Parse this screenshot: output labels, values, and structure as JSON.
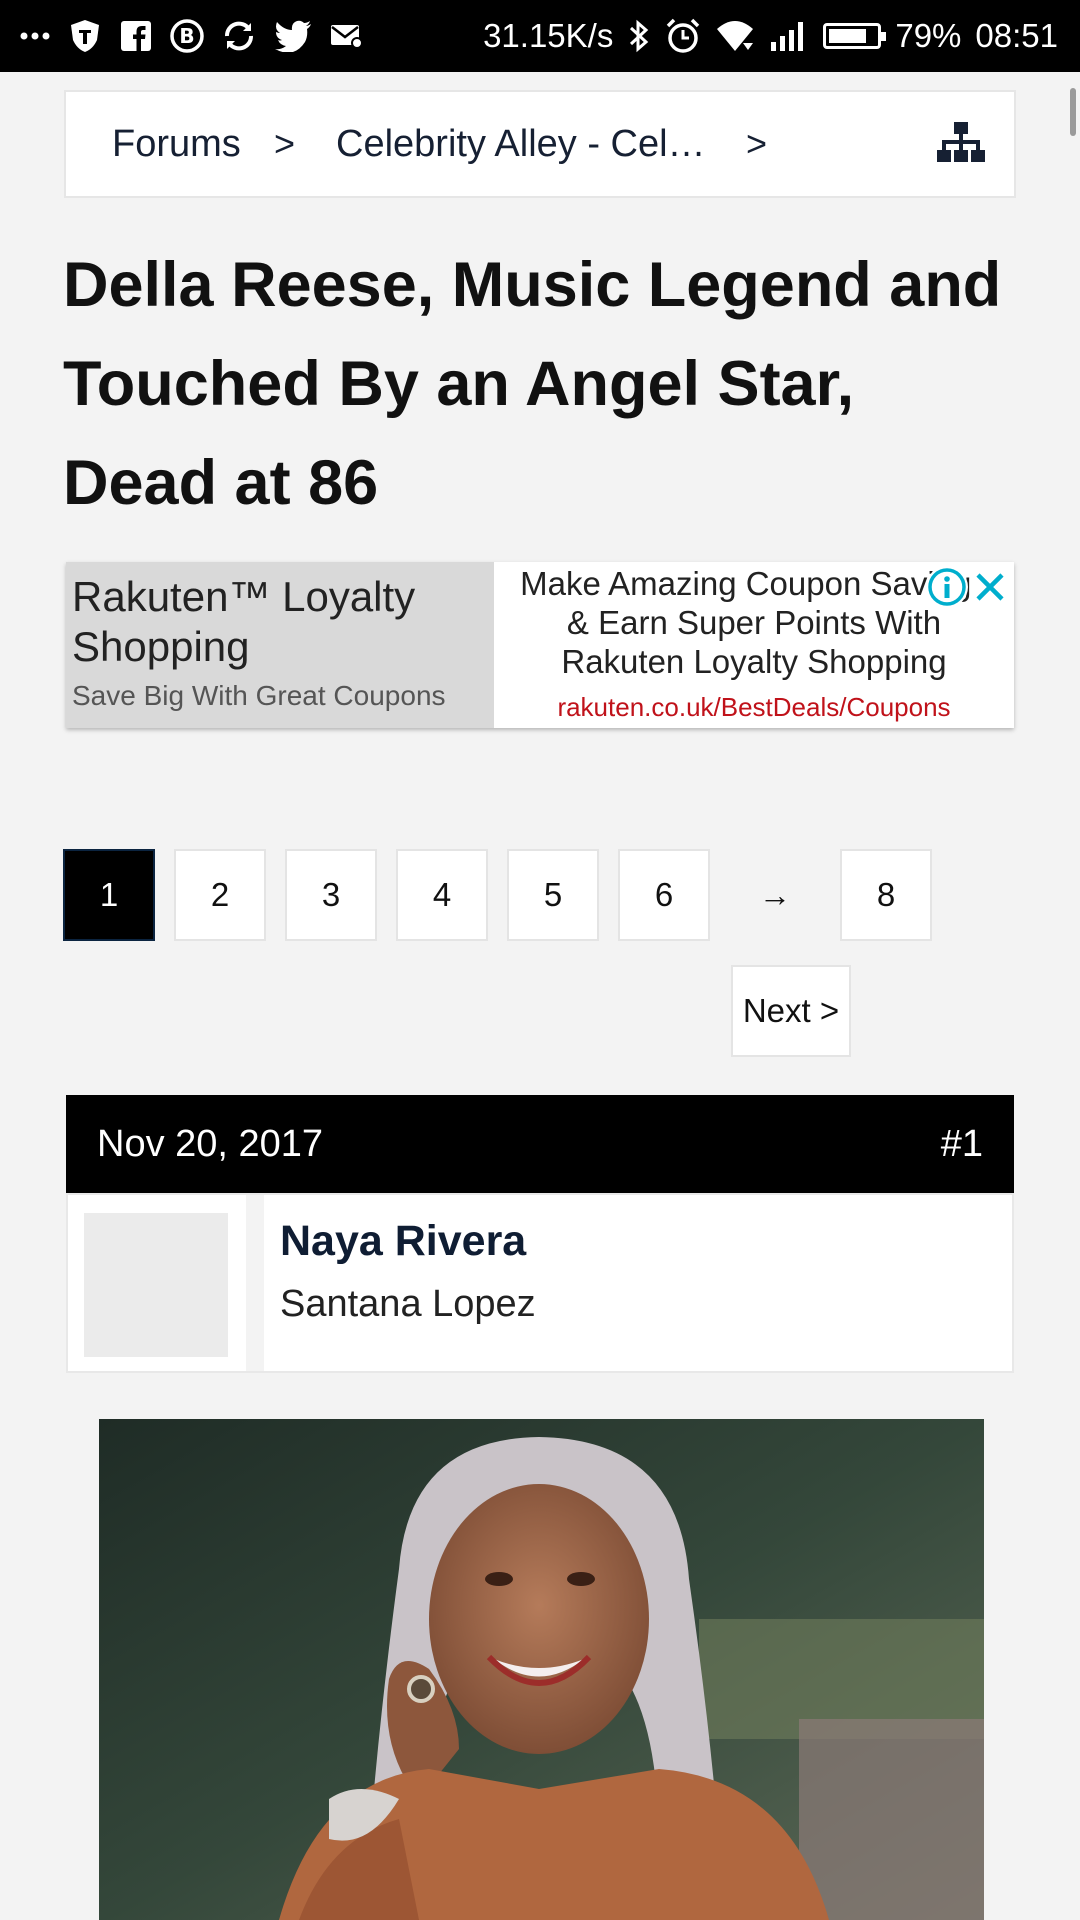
{
  "status_bar": {
    "network_speed": "31.15K/s",
    "battery_level": 0.79,
    "battery_percent": "79%",
    "time": "08:51",
    "icons": [
      "more-dots-icon",
      "shield-icon",
      "facebook-icon",
      "bitcoin-icon",
      "sync-icon",
      "twitter-icon",
      "mail-icon",
      "bluetooth-icon",
      "alarm-icon",
      "wifi-icon",
      "signal-icon",
      "battery-icon"
    ]
  },
  "breadcrumb": {
    "items": [
      "Forums",
      "Celebrity Alley - Cel…"
    ],
    "separator": ">",
    "icon": "sitemap-icon"
  },
  "thread": {
    "title": "Della Reese, Music Legend and Touched By an Angel Star, Dead at 86"
  },
  "ad": {
    "headline": "Rakuten™ Loyalty Shopping",
    "subline": "Save Big With Great Coupons",
    "description": "Make Amazing Coupon Savings\n& Earn Super Points With\nRakuten Loyalty Shopping",
    "url": "rakuten.co.uk/BestDeals/Coupons",
    "url_color": "#c0121a",
    "accent": "#00aecd",
    "icons": [
      "info-icon",
      "close-icon"
    ]
  },
  "pagination": {
    "pages": [
      "1",
      "2",
      "3",
      "4",
      "5",
      "6"
    ],
    "gap_symbol": "→",
    "last_page": "8",
    "current_page": "1",
    "next_label": "Next >"
  },
  "post": {
    "date": "Nov 20, 2017",
    "number": "#1",
    "author": "Naya Rivera",
    "author_title": "Santana Lopez"
  },
  "colors": {
    "background": "#f3f3f3",
    "header_black": "#000000",
    "link_dark": "#162033"
  }
}
